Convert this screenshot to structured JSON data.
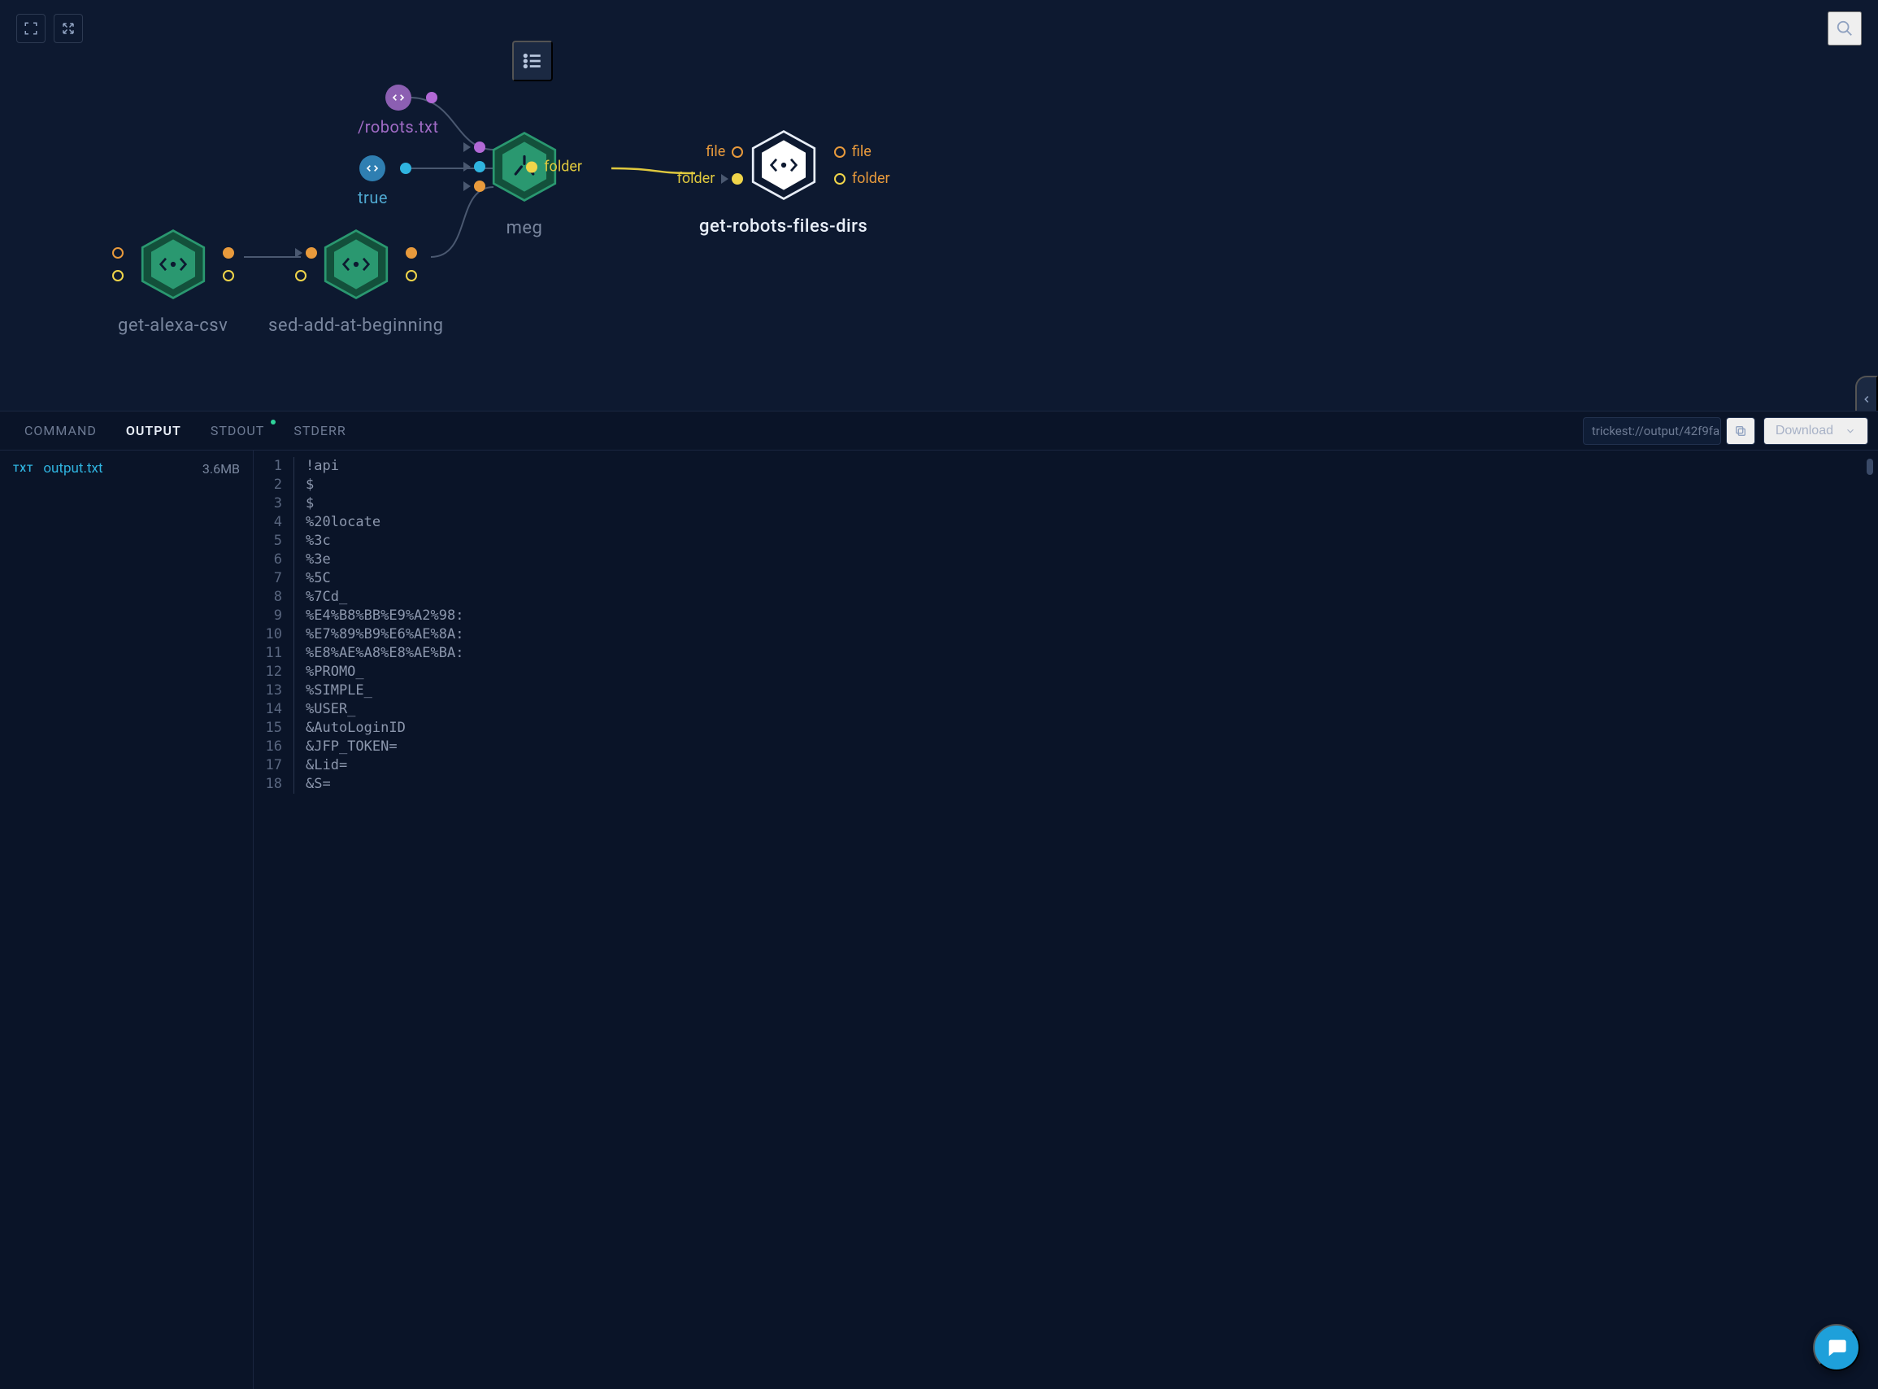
{
  "toolbar": {
    "center_icon": "list"
  },
  "nodes": {
    "robots": {
      "label": "/robots.txt"
    },
    "true": {
      "label": "true"
    },
    "alexa": {
      "label": "get-alexa-csv"
    },
    "sed": {
      "label": "sed-add-at-beginning"
    },
    "meg": {
      "label": "meg",
      "out_label": "folder"
    },
    "getrobots": {
      "label": "get-robots-files-dirs",
      "in_file": "file",
      "in_folder": "folder",
      "out_file": "file",
      "out_folder": "folder"
    }
  },
  "panel": {
    "tabs": {
      "command": "COMMAND",
      "output": "OUTPUT",
      "stdout": "STDOUT",
      "stderr": "STDERR"
    },
    "path": "trickest://output/42f9fa",
    "download": "Download",
    "file": {
      "badge": "TXT",
      "name": "output.txt",
      "size": "3.6MB"
    },
    "lines": [
      "!api",
      "$",
      "$",
      "%20locate",
      "%3c",
      "%3e",
      "%5C",
      "%7Cd_",
      "%E4%B8%BB%E9%A2%98:",
      "%E7%89%B9%E6%AE%8A:",
      "%E8%AE%A8%E8%AE%BA:",
      "%PROMO_",
      "%SIMPLE_",
      "%USER_",
      "&AutoLoginID",
      "&JFP_TOKEN=",
      "&Lid=",
      "&S="
    ]
  },
  "colors": {
    "purple": "#b269d6",
    "blue": "#2fb4e0",
    "orange": "#e89a3c",
    "yellow": "#f0d54a",
    "green": "#2a9870",
    "darkgreen": "#13503b"
  }
}
